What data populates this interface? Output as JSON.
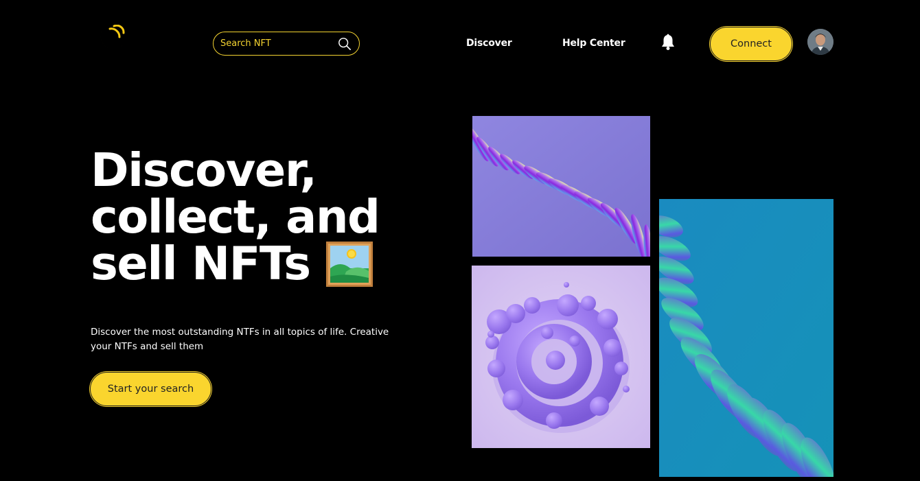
{
  "header": {
    "logo_icon": "crescent-logo-icon",
    "search": {
      "placeholder": "Search NFT",
      "icon": "search-icon"
    },
    "nav": {
      "discover_label": "Discover",
      "help_label": "Help Center"
    },
    "notifications_icon": "bell-icon",
    "connect_label": "Connect",
    "avatar_icon": "user-avatar"
  },
  "hero": {
    "title_line1": "Discover,",
    "title_line2": "collect, and",
    "title_line3": "sell NFTs",
    "title_icon": "framed-picture-icon",
    "description": "Discover the most outstanding NTFs in all topics of life. Creative your NTFs and sell them",
    "cta_label": "Start your search"
  },
  "gallery": {
    "items": [
      "purple-spiral-ribbon-art",
      "lavender-bubble-swirl-art",
      "teal-wave-ribbon-art"
    ]
  },
  "colors": {
    "accent": "#fad52e",
    "background": "#000000",
    "text": "#ffffff"
  }
}
